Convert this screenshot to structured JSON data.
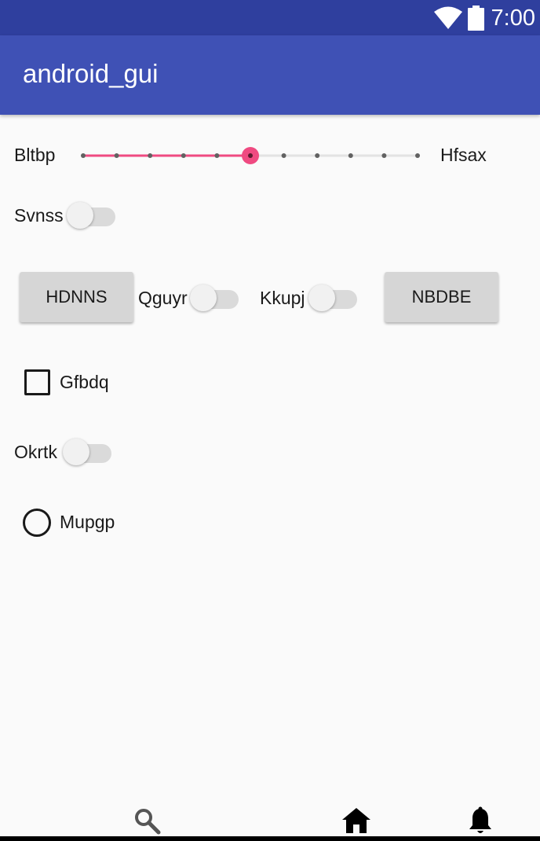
{
  "status_bar": {
    "time": "7:00",
    "icons": [
      "wifi-icon",
      "battery-icon"
    ],
    "color": "#2f3f9e"
  },
  "app_bar": {
    "title": "android_gui",
    "color": "#3f51b5"
  },
  "seekbar": {
    "left_label": "Bltbp",
    "right_label": "Hfsax",
    "tick_count": 11,
    "value_index": 5,
    "accent_color": "#ef4a81"
  },
  "switch_svnss": {
    "label": "Svnss",
    "checked": false
  },
  "button_row": {
    "button_left": "HDNNS",
    "switch_qguyr": {
      "label": "Qguyr",
      "checked": false
    },
    "switch_kkupj": {
      "label": "Kkupj",
      "checked": false
    },
    "button_right": "NBDBE"
  },
  "checkbox": {
    "label": "Gfbdq",
    "checked": false
  },
  "switch_okrtk": {
    "label": "Okrtk",
    "checked": false
  },
  "radio": {
    "label": "Mupgp",
    "checked": false
  },
  "bottom_nav": {
    "icons": [
      "search-icon",
      "home-icon",
      "bell-icon"
    ]
  }
}
